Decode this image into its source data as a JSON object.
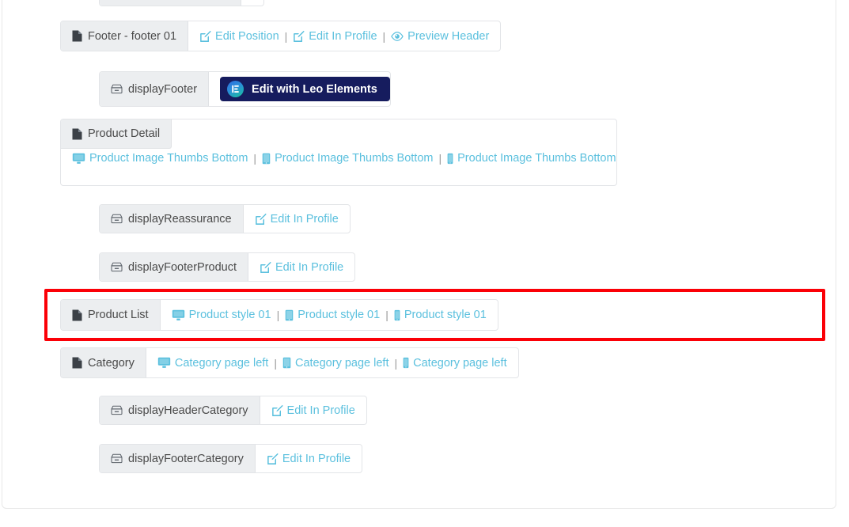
{
  "theme": {
    "link_color": "#5bc0de",
    "label_bg": "#eceef0",
    "row_border": "#e3e5e8",
    "highlight_color": "#fb0007",
    "button_bg": "#161c5e"
  },
  "common": {
    "edit_in_profile": "Edit In Profile",
    "edit_position": "Edit Position",
    "preview_header": "Preview Header",
    "separator": "|"
  },
  "rows": [
    {
      "id": "cutoff-top",
      "level": "nested",
      "type": "cutoff",
      "label": "",
      "links": []
    },
    {
      "id": "footer-footer-01",
      "level": "top",
      "type": "oneline",
      "label": "Footer - footer 01",
      "label_icon": "file-icon",
      "links": [
        {
          "text": "Edit Position",
          "icon": "edit-pencil-icon"
        },
        {
          "text": "Edit In Profile",
          "icon": "edit-pencil-icon"
        },
        {
          "text": "Preview Header",
          "icon": "eye-icon"
        }
      ]
    },
    {
      "id": "displayFooter",
      "level": "nested",
      "type": "hook-button",
      "label": "displayFooter",
      "label_icon": "hook-icon",
      "button": {
        "text": "Edit with Leo Elements",
        "logo": "leo-elements-logo-icon"
      }
    },
    {
      "id": "product-detail",
      "level": "top",
      "type": "block",
      "label": "Product Detail",
      "label_icon": "file-icon",
      "links": [
        {
          "text": "Product Image Thumbs Bottom",
          "icon": "desktop-icon"
        },
        {
          "text": "Product Image Thumbs Bottom",
          "icon": "tablet-icon"
        },
        {
          "text": "Product Image Thumbs Bottom",
          "icon": "mobile-icon"
        }
      ]
    },
    {
      "id": "displayReassurance",
      "level": "nested",
      "type": "oneline",
      "label": "displayReassurance",
      "label_icon": "hook-icon",
      "links": [
        {
          "text": "Edit In Profile",
          "icon": "edit-pencil-icon"
        }
      ]
    },
    {
      "id": "displayFooterProduct",
      "level": "nested",
      "type": "oneline",
      "label": "displayFooterProduct",
      "label_icon": "hook-icon",
      "links": [
        {
          "text": "Edit In Profile",
          "icon": "edit-pencil-icon"
        }
      ]
    },
    {
      "id": "product-list",
      "level": "top",
      "type": "oneline",
      "highlighted": true,
      "label": "Product List",
      "label_icon": "file-icon",
      "links": [
        {
          "text": "Product style 01",
          "icon": "desktop-icon"
        },
        {
          "text": "Product style 01",
          "icon": "tablet-icon"
        },
        {
          "text": "Product style 01",
          "icon": "mobile-icon"
        }
      ]
    },
    {
      "id": "category",
      "level": "top",
      "type": "oneline",
      "label": "Category",
      "label_icon": "file-icon",
      "links": [
        {
          "text": "Category page left",
          "icon": "desktop-icon"
        },
        {
          "text": "Category page left",
          "icon": "tablet-icon"
        },
        {
          "text": "Category page left",
          "icon": "mobile-icon"
        }
      ]
    },
    {
      "id": "displayHeaderCategory",
      "level": "nested",
      "type": "oneline",
      "label": "displayHeaderCategory",
      "label_icon": "hook-icon",
      "links": [
        {
          "text": "Edit In Profile",
          "icon": "edit-pencil-icon"
        }
      ]
    },
    {
      "id": "displayFooterCategory",
      "level": "nested",
      "type": "oneline",
      "label": "displayFooterCategory",
      "label_icon": "hook-icon",
      "links": [
        {
          "text": "Edit In Profile",
          "icon": "edit-pencil-icon"
        }
      ]
    }
  ]
}
